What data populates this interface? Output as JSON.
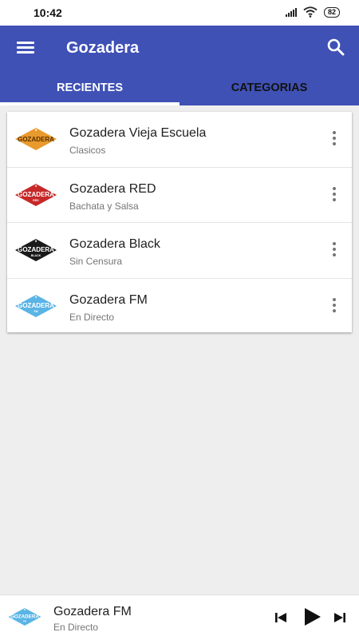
{
  "status_bar": {
    "time": "10:42",
    "battery": "82"
  },
  "app_bar": {
    "title": "Gozadera",
    "menu_icon": "hamburger-menu-icon",
    "search_icon": "search-icon"
  },
  "tabs": [
    {
      "label": "RECIENTES",
      "selected": true
    },
    {
      "label": "CATEGORIAS",
      "selected": false
    }
  ],
  "stations": [
    {
      "name": "Gozadera Vieja Escuela",
      "subtitle": "Clasicos",
      "logo_text": "GOZADERA",
      "logo_color": "#e89a2c",
      "logo_text_color": "#5a3000",
      "logo_tag": ""
    },
    {
      "name": "Gozadera RED",
      "subtitle": "Bachata y Salsa",
      "logo_text": "GOZADERA",
      "logo_color": "#c62828",
      "logo_text_color": "#ffffff",
      "logo_tag": "RED"
    },
    {
      "name": "Gozadera Black",
      "subtitle": "Sin Censura",
      "logo_text": "GOZADERA",
      "logo_color": "#1a1a1a",
      "logo_text_color": "#ffffff",
      "logo_tag": "BLACK"
    },
    {
      "name": "Gozadera FM",
      "subtitle": "En Directo",
      "logo_text": "GOZADERA",
      "logo_color": "#5ab4e5",
      "logo_text_color": "#ffffff",
      "logo_tag": "FM"
    }
  ],
  "player": {
    "title": "Gozadera FM",
    "subtitle": "En Directo",
    "logo_text": "GOZADERA",
    "logo_color": "#5ab4e5",
    "logo_tag": "FM",
    "prev_icon": "skip-previous-icon",
    "play_icon": "play-icon",
    "next_icon": "skip-next-icon"
  },
  "colors": {
    "primary": "#3f51b5",
    "background": "#eeeeee",
    "surface": "#ffffff"
  }
}
